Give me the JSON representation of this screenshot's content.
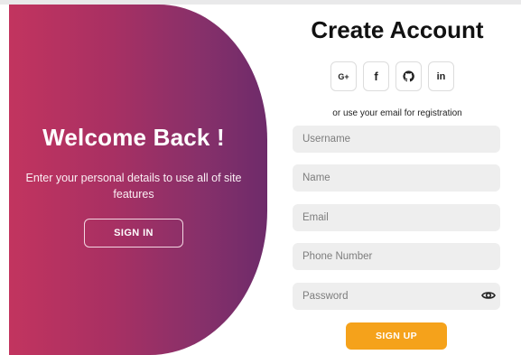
{
  "welcome": {
    "title": "Welcome Back !",
    "text": "Enter your personal details to use all of site features",
    "signin_label": "SIGN IN"
  },
  "form": {
    "title": "Create Account",
    "social": [
      {
        "label": "G+",
        "icon": "google-plus-icon"
      },
      {
        "label": "f",
        "icon": "facebook-icon"
      },
      {
        "label": "",
        "icon": "github-icon"
      },
      {
        "label": "in",
        "icon": "linkedin-icon"
      }
    ],
    "hint": "or use your email for registration",
    "fields": {
      "username": {
        "placeholder": "Username",
        "value": ""
      },
      "name": {
        "placeholder": "Name",
        "value": ""
      },
      "email": {
        "placeholder": "Email",
        "value": ""
      },
      "phone": {
        "placeholder": "Phone Number",
        "value": ""
      },
      "password": {
        "placeholder": "Password",
        "value": ""
      }
    },
    "password_toggle_icon": "eye-icon",
    "signup_label": "SIGN UP"
  },
  "colors": {
    "gradient_start": "#c2345f",
    "gradient_end": "#6e2b6a",
    "signup_button": "#f5a21b",
    "field_background": "#eeeeee"
  }
}
